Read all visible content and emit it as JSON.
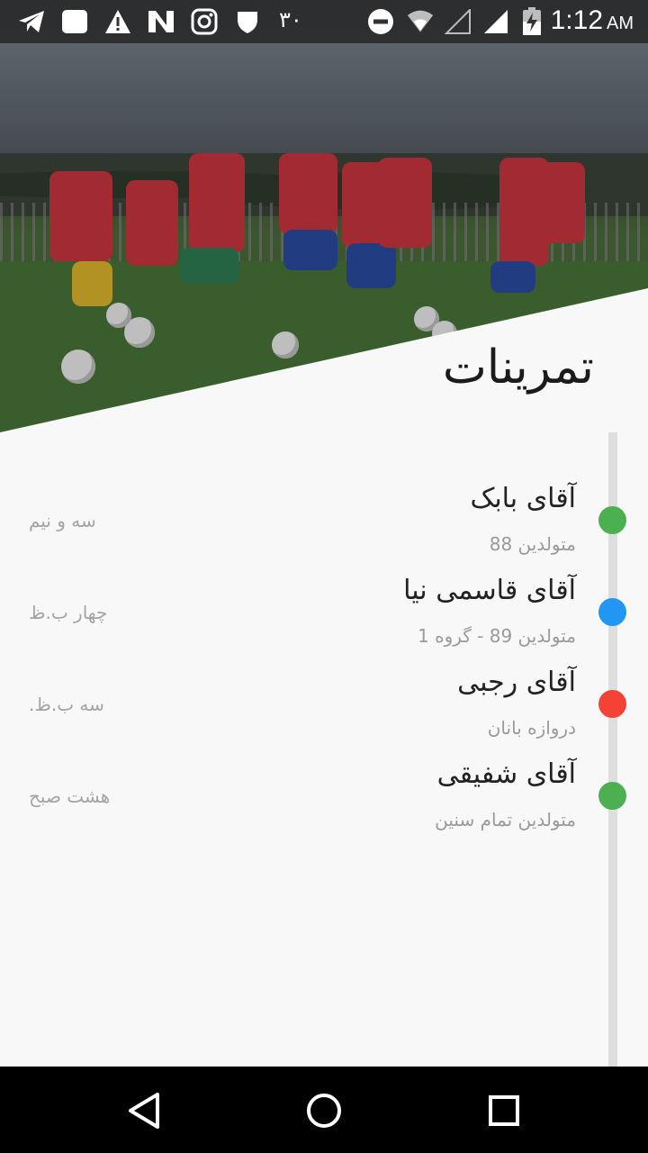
{
  "status_bar": {
    "time": "1:12",
    "ampm": "AM",
    "digits": "۳۰",
    "icons": [
      "telegram-icon",
      "message-icon",
      "warning-icon",
      "n-logo-icon",
      "instagram-icon",
      "shield-icon",
      "do-not-disturb-icon",
      "wifi-icon",
      "signal-empty-icon",
      "signal-full-icon",
      "battery-charging-icon"
    ]
  },
  "page": {
    "title": "تمرینات"
  },
  "timeline": [
    {
      "name": "آقای بابک",
      "subtitle": "متولدین 88",
      "time": "سه و نیم",
      "color": "#4caf50"
    },
    {
      "name": "آقای قاسمی نیا",
      "subtitle": "متولدین 89 - گروه 1",
      "time": "چهار ب.ظ",
      "color": "#2196f3"
    },
    {
      "name": "آقای رجبی",
      "subtitle": "دروازه بانان",
      "time": "سه ب.ظ.",
      "color": "#f44336"
    },
    {
      "name": "آقای شفیقی",
      "subtitle": "متولدین تمام سنین",
      "time": "هشت صبح",
      "color": "#4caf50"
    }
  ],
  "nav": {
    "buttons": [
      "back-icon",
      "home-icon",
      "recents-icon"
    ]
  }
}
